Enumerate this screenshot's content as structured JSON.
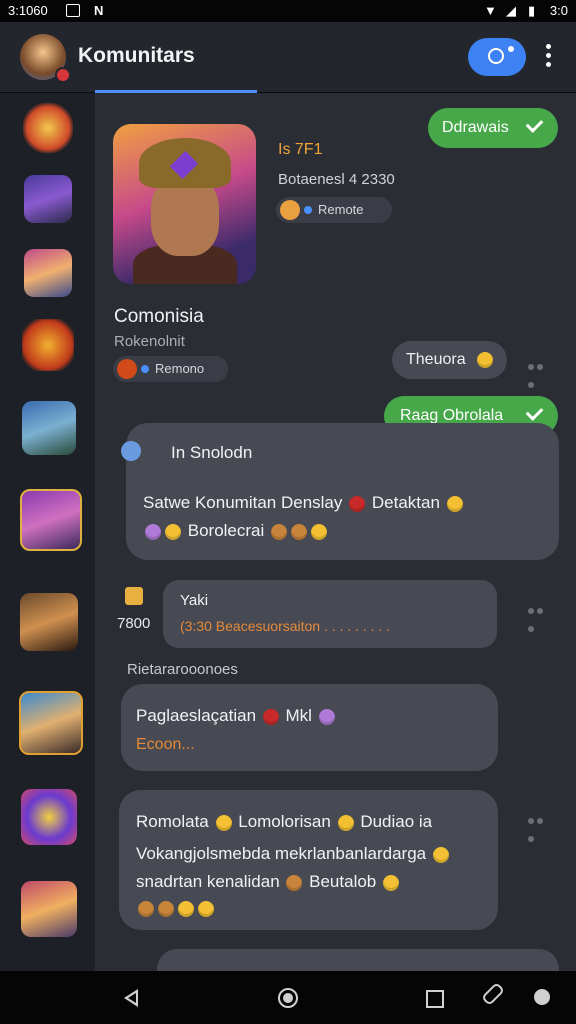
{
  "status": {
    "time": "3:1060",
    "right_time": "3:0"
  },
  "appbar": {
    "title": "Komunitars"
  },
  "profile": {
    "stat": "Is 7F1",
    "subtitle": "Botaenesl 4 2330",
    "pill": "Remote",
    "name": "Comonisia",
    "role": "Rokenolnit",
    "pill2": "Remono"
  },
  "actions": {
    "green_top": "Ddrawais",
    "grey_chip": "Theuora",
    "green_second": "Raag Obrolala"
  },
  "messages": [
    {
      "header": "In Snolodn",
      "line1": "Satwe Konumitan Denslay",
      "line1b": "Detaktan",
      "line2": "Borolecrai"
    },
    {
      "title": "Yaki",
      "meta": "7800",
      "body": "(3:30 Beacesuorsaiton . . . . . . . . ."
    },
    {
      "label": "Rietararooonoes",
      "line1": "Paglaeslaçatian",
      "line1b": "Mkl",
      "line2": "Ecoon..."
    },
    {
      "line1a": "Romolata",
      "line1b": "Lomolorisan",
      "line1c": "Dudiao ia",
      "line2": "Vokangjolsmebda mekrlanbanlardarga",
      "line3a": "snadrtan kenalidan",
      "line3b": "Beutalob"
    }
  ],
  "colors": {
    "accent": "#3d82f2",
    "green": "#47a84a",
    "bubble": "#474a52",
    "bg": "#2a2d34"
  }
}
